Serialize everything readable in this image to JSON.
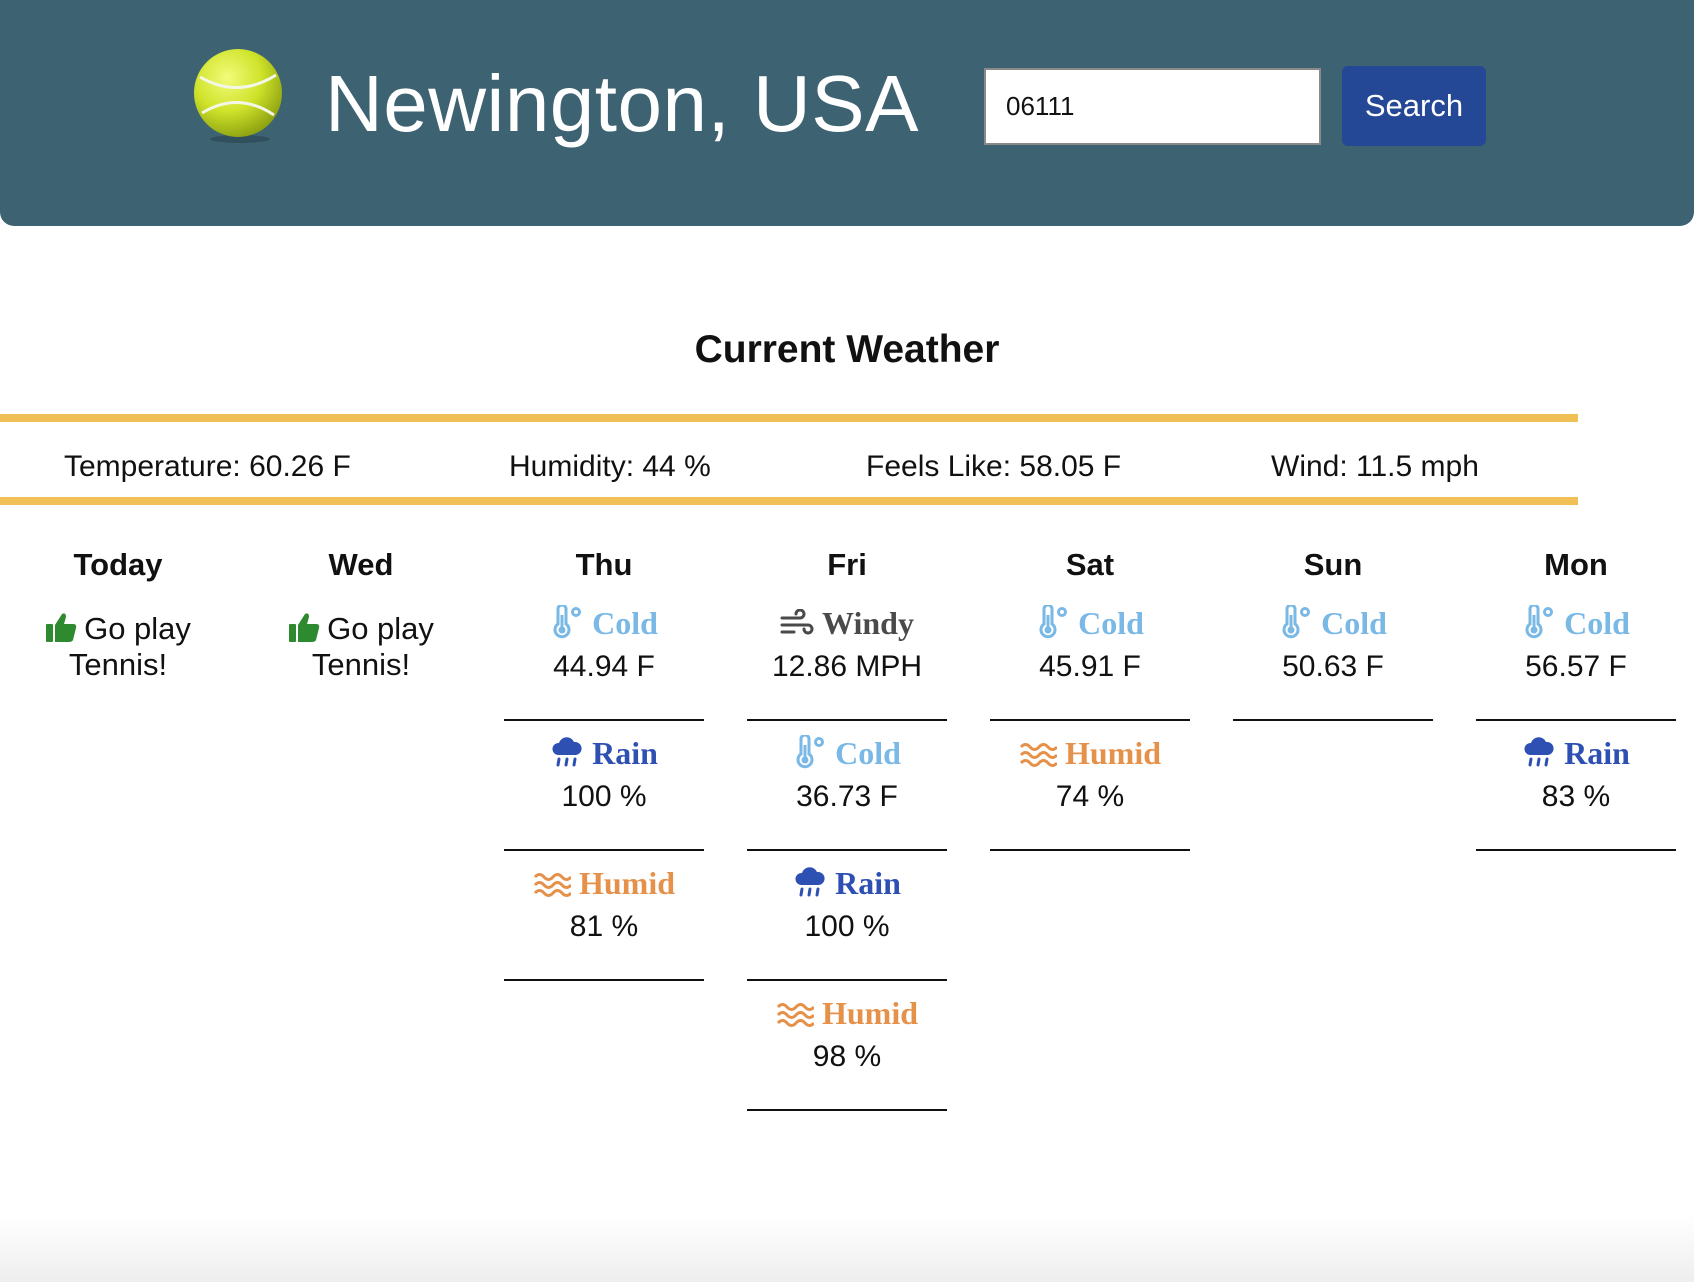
{
  "header": {
    "city": "Newington, USA",
    "search_value": "06111",
    "search_button": "Search",
    "logo_icon": "tennis-ball-icon"
  },
  "current": {
    "heading": "Current Weather",
    "temperature": "Temperature: 60.26 F",
    "humidity": "Humidity: 44 %",
    "feels_like": "Feels Like: 58.05 F",
    "wind": "Wind: 11.5 mph"
  },
  "forecast": [
    {
      "day": "Today",
      "advice": "Go play Tennis!",
      "cards": []
    },
    {
      "day": "Wed",
      "advice": "Go play Tennis!",
      "cards": []
    },
    {
      "day": "Thu",
      "advice": "",
      "cards": [
        {
          "type": "cold",
          "label": "Cold",
          "value": "44.94 F"
        },
        {
          "type": "rain",
          "label": "Rain",
          "value": "100 %"
        },
        {
          "type": "humid",
          "label": "Humid",
          "value": "81 %"
        }
      ]
    },
    {
      "day": "Fri",
      "advice": "",
      "cards": [
        {
          "type": "windy",
          "label": "Windy",
          "value": "12.86 MPH"
        },
        {
          "type": "cold",
          "label": "Cold",
          "value": "36.73 F"
        },
        {
          "type": "rain",
          "label": "Rain",
          "value": "100 %"
        },
        {
          "type": "humid",
          "label": "Humid",
          "value": "98 %"
        }
      ]
    },
    {
      "day": "Sat",
      "advice": "",
      "cards": [
        {
          "type": "cold",
          "label": "Cold",
          "value": "45.91 F"
        },
        {
          "type": "humid",
          "label": "Humid",
          "value": "74 %"
        }
      ]
    },
    {
      "day": "Sun",
      "advice": "",
      "cards": [
        {
          "type": "cold",
          "label": "Cold",
          "value": "50.63 F"
        }
      ]
    },
    {
      "day": "Mon",
      "advice": "",
      "cards": [
        {
          "type": "cold",
          "label": "Cold",
          "value": "56.57 F"
        },
        {
          "type": "rain",
          "label": "Rain",
          "value": "83 %"
        }
      ]
    }
  ],
  "colors": {
    "header_bg": "#3d6372",
    "button_bg": "#244796",
    "accent_bar": "#f0bf55",
    "cold": "#7ab8e6",
    "rain": "#2e50b3",
    "humid": "#e6914a",
    "windy": "#4a4a4a",
    "thumb": "#2e8a2e"
  }
}
